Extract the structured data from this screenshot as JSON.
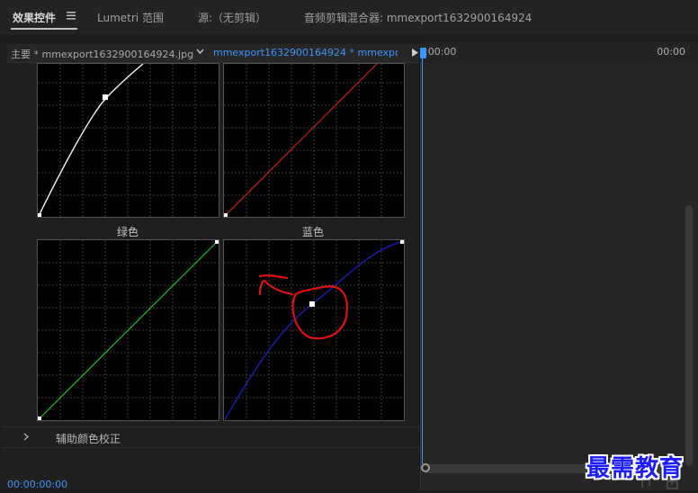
{
  "tabs": [
    {
      "label": "效果控件",
      "active": true
    },
    {
      "label": "Lumetri 范围",
      "active": false
    },
    {
      "label": "源:（无剪辑）",
      "active": false
    },
    {
      "label": "音频剪辑混合器: mmexport1632900164924",
      "active": false
    }
  ],
  "clip_bar": {
    "master": "主要 * mmexport1632900164924.jpg",
    "sequence": "mmexport1632900164924 * mmexport1..."
  },
  "curves": {
    "green_label": "绿色",
    "blue_label": "蓝色",
    "colors": {
      "master": "#ffffff",
      "red": "#c81e1e",
      "green": "#22c622",
      "blue": "#1c1cc8",
      "annotation": "#e01010"
    }
  },
  "helper": {
    "label": "辅助颜色校正"
  },
  "timecode": "00:00:00:00",
  "timeline": {
    "start": ":00:00",
    "end": "00:00"
  },
  "watermark": "最需教育",
  "icons": {
    "menu": "hamburger-icon",
    "dropdown": "chevron-down-icon",
    "play": "triangle-right-icon",
    "expand": "chevron-right-icon"
  }
}
